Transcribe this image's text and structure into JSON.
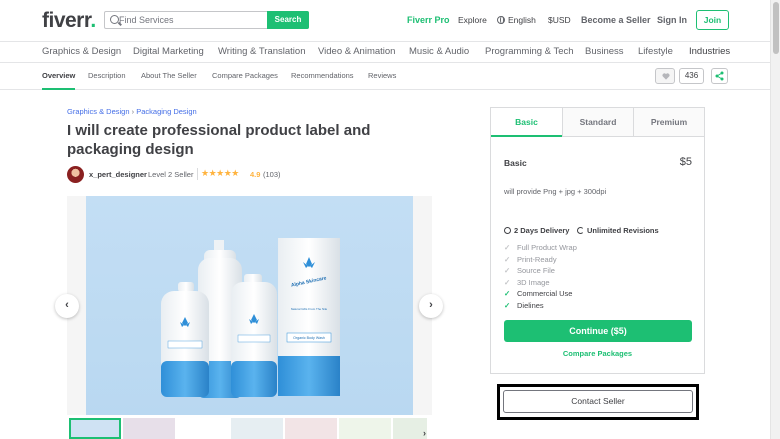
{
  "header": {
    "logo": "fiverr",
    "logo_dot": ".",
    "search_placeholder": "Find Services",
    "search_button": "Search",
    "fiverr_pro": "Fiverr Pro",
    "explore": "Explore",
    "language": "English",
    "currency": "$USD",
    "become_seller": "Become a Seller",
    "sign_in": "Sign In",
    "join": "Join"
  },
  "categories": [
    "Graphics & Design",
    "Digital Marketing",
    "Writing & Translation",
    "Video & Animation",
    "Music & Audio",
    "Programming & Tech",
    "Business",
    "Lifestyle",
    "Industries"
  ],
  "subnav": {
    "items": [
      "Overview",
      "Description",
      "About The Seller",
      "Compare Packages",
      "Recommendations",
      "Reviews"
    ],
    "like_count": "436"
  },
  "breadcrumb": {
    "parent": "Graphics & Design",
    "separator": "›",
    "child": "Packaging Design"
  },
  "gig": {
    "title": "I will create professional product label and packaging design",
    "seller_name": "x_pert_designer",
    "seller_level": "Level 2 Seller",
    "stars": "★★★★★",
    "rating": "4.9",
    "review_count": "(103)"
  },
  "gallery": {
    "prev": "‹",
    "next": "›",
    "brand": "Alpha Skincare",
    "tagline": "Natural Gifts From The Nile",
    "product": "Organic Body Wash"
  },
  "packages": {
    "tabs": [
      "Basic",
      "Standard",
      "Premium"
    ],
    "name": "Basic",
    "price": "$5",
    "description": "will provide Png + jpg + 300dpi",
    "delivery": "2 Days Delivery",
    "revisions": "Unlimited Revisions",
    "features": [
      {
        "label": "Full Product Wrap",
        "included": false
      },
      {
        "label": "Print-Ready",
        "included": false
      },
      {
        "label": "Source File",
        "included": false
      },
      {
        "label": "3D Image",
        "included": false
      },
      {
        "label": "Commercial Use",
        "included": true
      },
      {
        "label": "Dielines",
        "included": true
      }
    ],
    "continue": "Continue ($5)",
    "compare": "Compare Packages"
  },
  "contact_seller": "Contact Seller",
  "colors": {
    "brand_green": "#1dbf73",
    "text": "#404145",
    "link_blue": "#446ee7",
    "star": "#ffb33e",
    "image_bg": "#bcd9f2"
  }
}
